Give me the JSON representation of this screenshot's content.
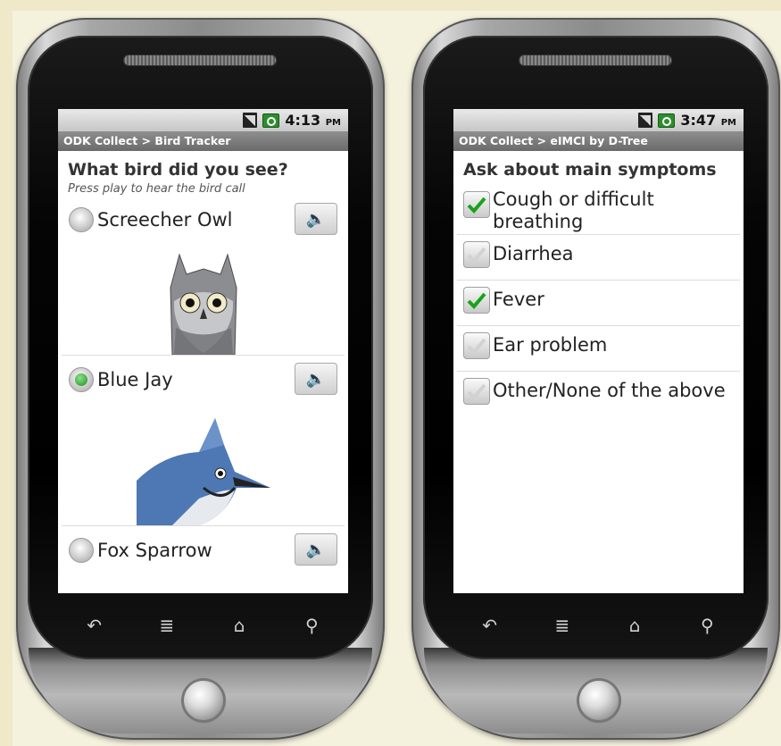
{
  "left_phone": {
    "status_time": "4:13",
    "status_ampm": "PM",
    "title": "ODK Collect > Bird Tracker",
    "question": "What bird did you see?",
    "hint": "Press play to hear the bird call",
    "options": [
      {
        "label": "Screecher Owl",
        "selected": false
      },
      {
        "label": "Blue Jay",
        "selected": true
      },
      {
        "label": "Fox Sparrow",
        "selected": false
      }
    ]
  },
  "right_phone": {
    "status_time": "3:47",
    "status_ampm": "PM",
    "title": "ODK Collect > eIMCI by D-Tree",
    "question": "Ask about main symptoms",
    "options": [
      {
        "label": "Cough or difficult breathing",
        "checked": true
      },
      {
        "label": "Diarrhea",
        "checked": false
      },
      {
        "label": "Fever",
        "checked": true
      },
      {
        "label": "Ear problem",
        "checked": false
      },
      {
        "label": "Other/None of the above",
        "checked": false
      }
    ]
  },
  "colors": {
    "accent_green": "#1e8f1e",
    "titlebar": "#7a7a7a"
  },
  "nav_icons": [
    "back-icon",
    "menu-icon",
    "home-icon",
    "search-icon"
  ]
}
